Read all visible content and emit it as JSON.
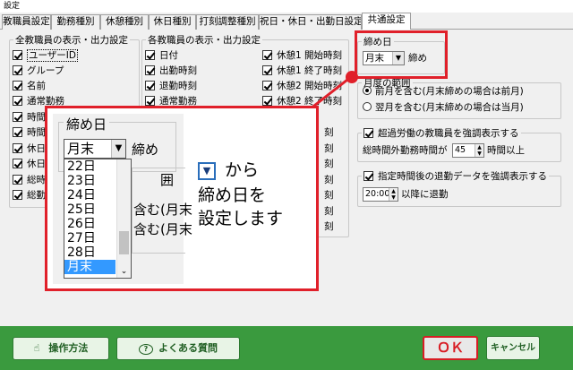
{
  "window": {
    "title": "設定"
  },
  "tabs": [
    {
      "label": "教職員設定"
    },
    {
      "label": "勤務種別"
    },
    {
      "label": "休憩種別"
    },
    {
      "label": "休日種別"
    },
    {
      "label": "打刻調整種別"
    },
    {
      "label": "祝日・休日・出勤日設定"
    },
    {
      "label": "共通設定"
    }
  ],
  "all_staff": {
    "title": "全教職員の表示・出力設定",
    "items": [
      {
        "label": "ユーザーID",
        "checked": true
      },
      {
        "label": "グループ",
        "checked": true
      },
      {
        "label": "名前",
        "checked": true
      },
      {
        "label": "通常勤務",
        "checked": true
      },
      {
        "label": "時間",
        "checked": true
      },
      {
        "label": "時間",
        "checked": true
      },
      {
        "label": "休日",
        "checked": true
      },
      {
        "label": "休日",
        "checked": true
      },
      {
        "label": "総時",
        "checked": true
      },
      {
        "label": "総勤",
        "checked": true
      }
    ]
  },
  "each_staff": {
    "title": "各教職員の表示・出力設定",
    "col1": [
      {
        "label": "日付",
        "checked": true
      },
      {
        "label": "出勤時刻",
        "checked": true
      },
      {
        "label": "退勤時刻",
        "checked": true
      },
      {
        "label": "通常勤務",
        "checked": true
      }
    ],
    "col2": [
      {
        "label": "休憩1 開始時刻",
        "checked": true
      },
      {
        "label": "休憩1 終了時刻",
        "checked": true
      },
      {
        "label": "休憩2 開始時刻",
        "checked": true
      },
      {
        "label": "休憩2 終了時刻",
        "checked": true
      }
    ],
    "col2_fragments": [
      "刻",
      "刻",
      "刻",
      "刻",
      "刻",
      "刻",
      "刻"
    ]
  },
  "closing": {
    "title": "締め日",
    "value": "月末",
    "suffix": "締め"
  },
  "monthly_range": {
    "title": "月度の範囲",
    "options": [
      {
        "label": "前月を含む(月末締めの場合は前月)",
        "checked": true
      },
      {
        "label": "翌月を含む(月末締めの場合は当月)",
        "checked": false
      }
    ]
  },
  "overtime": {
    "title": "超過労働の教職員を強調表示する",
    "checked": true,
    "prefix": "総時間外勤務時間が",
    "value": "45",
    "suffix": "時間以上"
  },
  "late_leave": {
    "title": "指定時間後の退勤データを強調表示する",
    "checked": true,
    "value": "20:00",
    "suffix": "以降に退勤"
  },
  "footer": {
    "manual_label": "操作方法",
    "faq_label": "よくある質問",
    "ok_label": "ＯＫ",
    "cancel_label": "キャンセル"
  },
  "callout": {
    "closing_title": "締め日",
    "closing_value": "月末",
    "closing_suffix": "締め",
    "dropdown_options": [
      "22日",
      "23日",
      "24日",
      "25日",
      "26日",
      "27日",
      "28日",
      "月末"
    ],
    "selected_option": "月末",
    "behind_fragment_1": "含む(月末",
    "behind_fragment_2": "含む(月末",
    "behind_legend_fragment": "囲",
    "instruction_line1": "から",
    "instruction_line2": "締め日を",
    "instruction_line3": "設定します"
  },
  "colors": {
    "accent_red": "#e0202a",
    "footer_green": "#3a9a3e",
    "selection_blue": "#3399ff"
  }
}
